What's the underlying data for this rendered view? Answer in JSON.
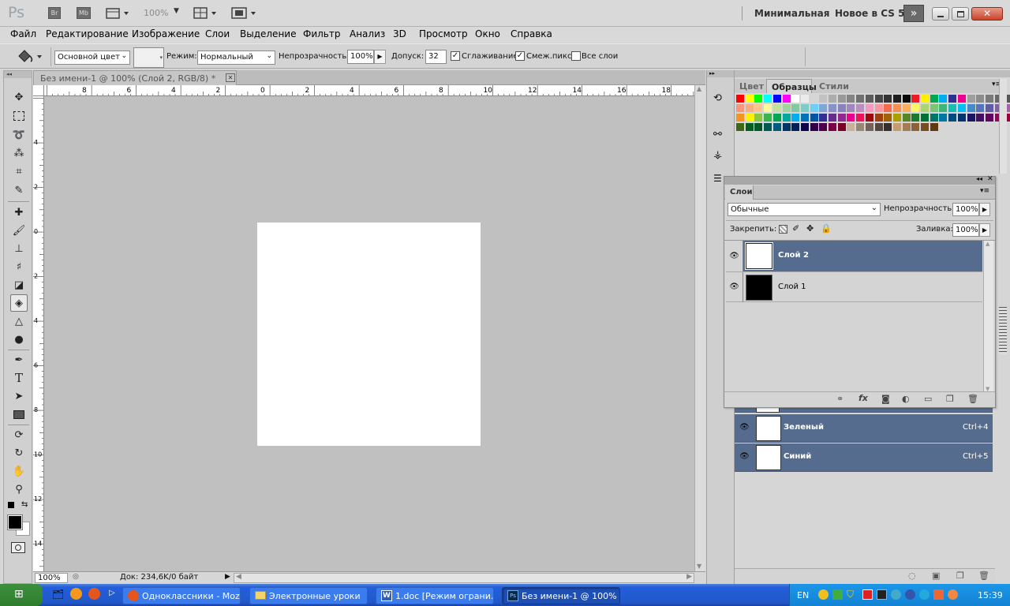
{
  "app": {
    "logo": "Ps",
    "bridge_label": "Br",
    "minibridge_label": "Mb",
    "zoom": "100%",
    "workspace": "Минимальная",
    "whats_new": "Новое в CS 5"
  },
  "menu": [
    "Файл",
    "Редактирование",
    "Изображение",
    "Слои",
    "Выделение",
    "Фильтр",
    "Анализ",
    "3D",
    "Просмотр",
    "Окно",
    "Справка"
  ],
  "options": {
    "fill_source": "Основной цвет",
    "mode_label": "Режим:",
    "mode_value": "Нормальный",
    "opacity_label": "Непрозрачность:",
    "opacity_value": "100%",
    "tolerance_label": "Допуск:",
    "tolerance_value": "32",
    "antialias_label": "Сглаживание",
    "contiguous_label": "Смеж.пикс",
    "all_layers_label": "Все слои",
    "antialias_checked": true,
    "contiguous_checked": true,
    "all_layers_checked": false
  },
  "document": {
    "tab_title": "Без имени-1 @ 100% (Слой 2, RGB/8) *",
    "status_zoom": "100%",
    "status_info": "Док: 234,6K/0 байт",
    "ruler_h": [
      "8",
      "6",
      "4",
      "2",
      "0",
      "2",
      "4",
      "6",
      "8",
      "10",
      "12",
      "14",
      "16",
      "18"
    ],
    "ruler_v": [
      "4",
      "2",
      "0",
      "2",
      "4",
      "6",
      "8",
      "10",
      "12",
      "14"
    ]
  },
  "swatch_panel": {
    "tabs": [
      "Цвет",
      "Образцы",
      "Стили"
    ],
    "active_tab": "Образцы",
    "colors": [
      [
        "#ff0000",
        "#ffff00",
        "#00ff00",
        "#00ffff",
        "#0000ff",
        "#ff00ff",
        "#ffffff",
        "#ebebeb",
        "#d6d6d6",
        "#c2c2c2",
        "#adadad",
        "#999999",
        "#858585",
        "#707070",
        "#5c5c5c",
        "#474747",
        "#333333",
        "#1f1f1f",
        "#0a0a0a",
        "#ed1c24",
        "#fff200",
        "#00a651",
        "#00aeef",
        "#2e3192",
        "#ec008c",
        "#9e9e9e",
        "#8c8c8c",
        "#7a7a7a",
        "#686868",
        "#565656",
        "#444444",
        "#323232",
        "#202020",
        "#000000"
      ],
      [
        "#f7977a",
        "#f9ad81",
        "#fdc68a",
        "#fff79a",
        "#c4df9b",
        "#a3d39c",
        "#82ca9d",
        "#7bcdc8",
        "#6ecff6",
        "#7ea7d8",
        "#8493ca",
        "#8882be",
        "#a187be",
        "#bc8dbf",
        "#f49ac2",
        "#f6989d",
        "#f26c4f",
        "#f68e55",
        "#fbaf5c",
        "#fff467",
        "#acd372",
        "#7cc576",
        "#3bb878",
        "#1abbb4",
        "#00bff3",
        "#438ccb",
        "#5574b9",
        "#605ca8",
        "#855fa8",
        "#a763a8",
        "#f06ea9",
        "#f26d7d",
        "#ed1c24",
        "#f26522"
      ],
      [
        "#f7941d",
        "#fff200",
        "#8dc63f",
        "#39b54a",
        "#00a651",
        "#00a99d",
        "#00aeef",
        "#0072bc",
        "#0054a6",
        "#2e3192",
        "#662d91",
        "#92278f",
        "#ec008c",
        "#ed145b",
        "#9e0b0f",
        "#a0410d",
        "#a36209",
        "#aba000",
        "#598527",
        "#1a7b30",
        "#007236",
        "#00746b",
        "#0076a3",
        "#004b80",
        "#003471",
        "#1b1464",
        "#440e62",
        "#630460",
        "#9e005d",
        "#9e0039",
        "#790000",
        "#7b2e00",
        "#7d4900",
        "#827b00"
      ],
      [
        "#406618",
        "#005e20",
        "#005826",
        "#005952",
        "#005b7f",
        "#003663",
        "#002157",
        "#0d004c",
        "#32004b",
        "#4b0049",
        "#7b0046",
        "#7a0026",
        "#c7b299",
        "#998675",
        "#736357",
        "#534741",
        "#37302a",
        "#c69c6d",
        "#a67c52",
        "#8c6239",
        "#754c24",
        "#603913"
      ]
    ]
  },
  "layers_panel": {
    "title": "Слои",
    "blend_mode": "Обычные",
    "opacity_label": "Непрозрачность:",
    "opacity_value": "100%",
    "lock_label": "Закрепить:",
    "fill_label": "Заливка:",
    "fill_value": "100%",
    "layers": [
      {
        "name": "Слой 2",
        "selected": true,
        "thumb": "#ffffff"
      },
      {
        "name": "Слой 1",
        "selected": false,
        "thumb": "#000000"
      }
    ]
  },
  "channels": [
    {
      "name": "Зеленый",
      "shortcut": "Ctrl+4"
    },
    {
      "name": "Синий",
      "shortcut": "Ctrl+5"
    }
  ],
  "taskbar": {
    "items": [
      "Одноклассники - Moz...",
      "Электронные уроки",
      "1.doc [Режим ограни...",
      "Без имени-1 @ 100% ..."
    ],
    "language": "EN",
    "clock": "15:39"
  }
}
